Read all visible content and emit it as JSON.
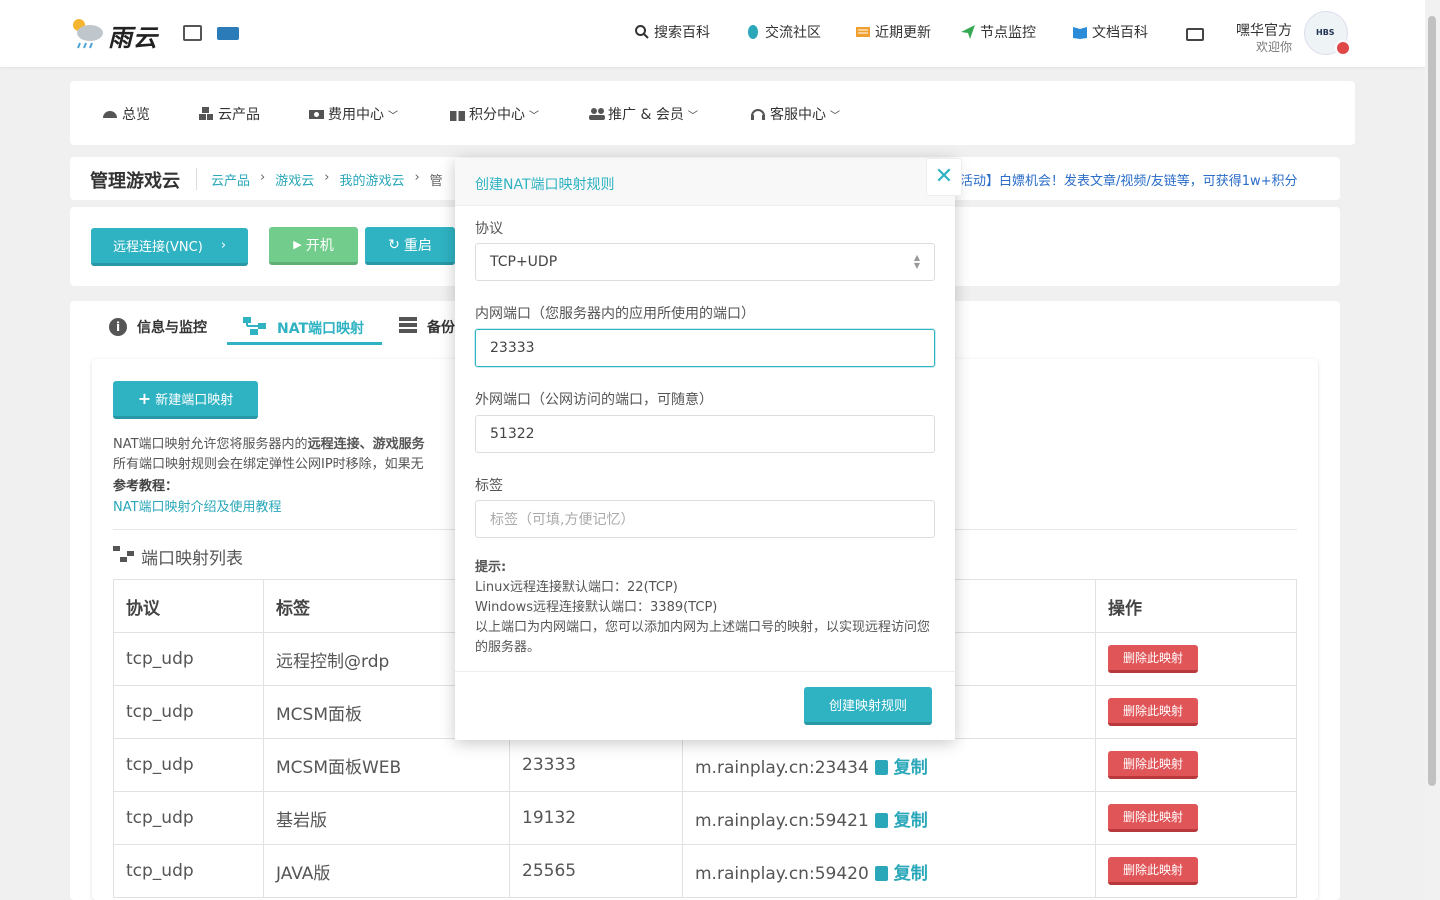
{
  "header": {
    "logo_text": "雨云",
    "nav": [
      {
        "label": "搜索百科",
        "icon": "search-icon"
      },
      {
        "label": "交流社区",
        "icon": "qq-icon"
      },
      {
        "label": "近期更新",
        "icon": "list-icon"
      },
      {
        "label": "节点监控",
        "icon": "send-icon"
      },
      {
        "label": "文档百科",
        "icon": "book-icon"
      }
    ],
    "user_name": "嘿华官方",
    "welcome": "欢迎你",
    "avatar_text": "HBS"
  },
  "menu": [
    {
      "label": "总览"
    },
    {
      "label": "云产品"
    },
    {
      "label": "费用中心"
    },
    {
      "label": "积分中心"
    },
    {
      "label": "推广 & 会员"
    },
    {
      "label": "客服中心"
    }
  ],
  "breadcrumb": {
    "title": "管理游戏云",
    "items": [
      "云产品",
      "游戏云",
      "我的游戏云",
      "管"
    ],
    "notice": "活动】白嫖机会！发表文章/视频/友链等，可获得1w+积分"
  },
  "actions": {
    "vnc": "远程连接(VNC)",
    "start": "开机",
    "restart": "重启"
  },
  "tabs": [
    "信息与监控",
    "NAT端口映射",
    "备份"
  ],
  "nat": {
    "new_button": "新建端口映射",
    "desc1_pre": "NAT端口映射允许您将服务器内的",
    "desc1_bold": "远程连接、游戏服务",
    "desc2": "所有端口映射规则会在绑定弹性公网IP时移除，如果无",
    "ref_label": "参考教程：",
    "ref_link": "NAT端口映射介绍及使用教程",
    "list_title": "端口映射列表"
  },
  "table": {
    "headers": [
      "协议",
      "标签",
      "",
      "",
      "操作"
    ],
    "rows": [
      {
        "proto": "tcp_udp",
        "tag": "远程控制@rdp",
        "inner": "",
        "addr": "",
        "copy": "",
        "del": "删除此映射"
      },
      {
        "proto": "tcp_udp",
        "tag": "MCSM面板",
        "inner": "",
        "addr": "",
        "copy": "",
        "del": "删除此映射"
      },
      {
        "proto": "tcp_udp",
        "tag": "MCSM面板WEB",
        "inner": "23333",
        "addr": "m.rainplay.cn:23434",
        "copy": "复制",
        "del": "删除此映射"
      },
      {
        "proto": "tcp_udp",
        "tag": "基岩版",
        "inner": "19132",
        "addr": "m.rainplay.cn:59421",
        "copy": "复制",
        "del": "删除此映射"
      },
      {
        "proto": "tcp_udp",
        "tag": "JAVA版",
        "inner": "25565",
        "addr": "m.rainplay.cn:59420",
        "copy": "复制",
        "del": "删除此映射"
      }
    ]
  },
  "modal": {
    "title": "创建NAT端口映射规则",
    "protocol_label": "协议",
    "protocol_value": "TCP+UDP",
    "inner_label": "内网端口（您服务器内的应用所使用的端口）",
    "inner_value": "23333",
    "outer_label": "外网端口（公网访问的端口，可随意）",
    "outer_value": "51322",
    "tag_label": "标签",
    "tag_placeholder": "标签（可填,方便记忆）",
    "hint_title": "提示:",
    "hint1": "Linux远程连接默认端口：22(TCP)",
    "hint2": "Windows远程连接默认端口：3389(TCP)",
    "hint3": "以上端口为内网端口，您可以添加内网为上述端口号的映射，以实现远程访问您的服务器。",
    "submit": "创建映射规则"
  },
  "colors": {
    "accent": "#2fb3c3",
    "danger": "#e05558",
    "start_green": "#72cd8c"
  }
}
